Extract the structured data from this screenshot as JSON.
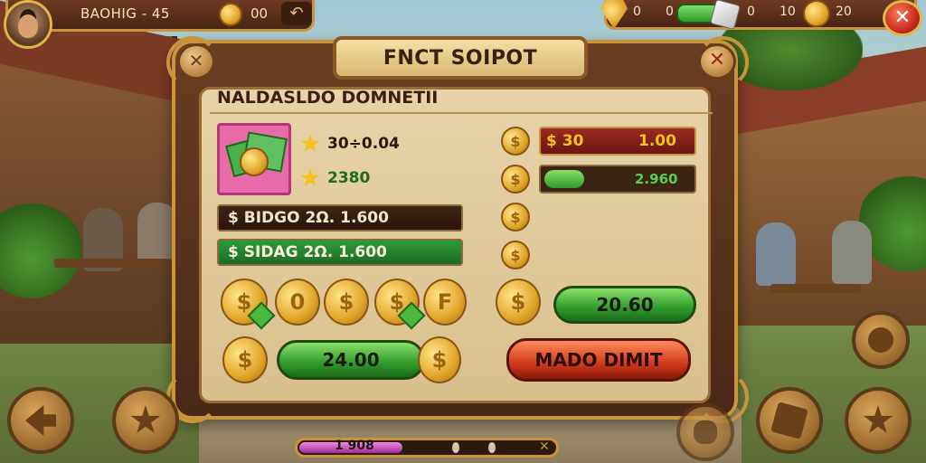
{
  "hud": {
    "player_name": "BAOHIG - 45",
    "coins": "00",
    "back_glyph": "↶",
    "shield_value": "0",
    "energy_value": "0",
    "dice_value": "0",
    "stat_value": "10",
    "coins_right": "20",
    "close_glyph": "✕"
  },
  "panel": {
    "title": "FNCT SOIPOT",
    "subtitle": "NALDASLDO DOMNETII",
    "close_glyph": "✕",
    "back_glyph": "✕",
    "item": {
      "stat1": "30÷0.04",
      "stat2": "2380"
    },
    "bars": {
      "dark_bar": "$ BIDGO 2Ω. 1.600",
      "green_bar": "$ SIDAG 2Ω. 1.600"
    },
    "right": {
      "red_bar_left": "$ 30",
      "red_bar_right": "1.00",
      "progress_value": "2.960",
      "progress_fraction": 0.27,
      "coin_glyph": "$"
    },
    "coin_row_glyphs": [
      "$",
      "0",
      "$",
      "$",
      "F"
    ],
    "buttons": {
      "green_main": "20.60",
      "green_secondary": "24.00",
      "red_action": "MADO DIMIT"
    }
  },
  "nav": {
    "back_icon": "arrow-left",
    "star_icon": "star",
    "bug_icon": "beetle",
    "cube_icon": "cube",
    "star_right_icon": "star"
  },
  "bottom": {
    "progress_label": "1 908",
    "progress_fraction": 0.4,
    "end_glyph": "✕"
  },
  "colors": {
    "panel_frame": "#c9943c",
    "button_green": "#2f9a2a",
    "button_red": "#d2391a"
  }
}
